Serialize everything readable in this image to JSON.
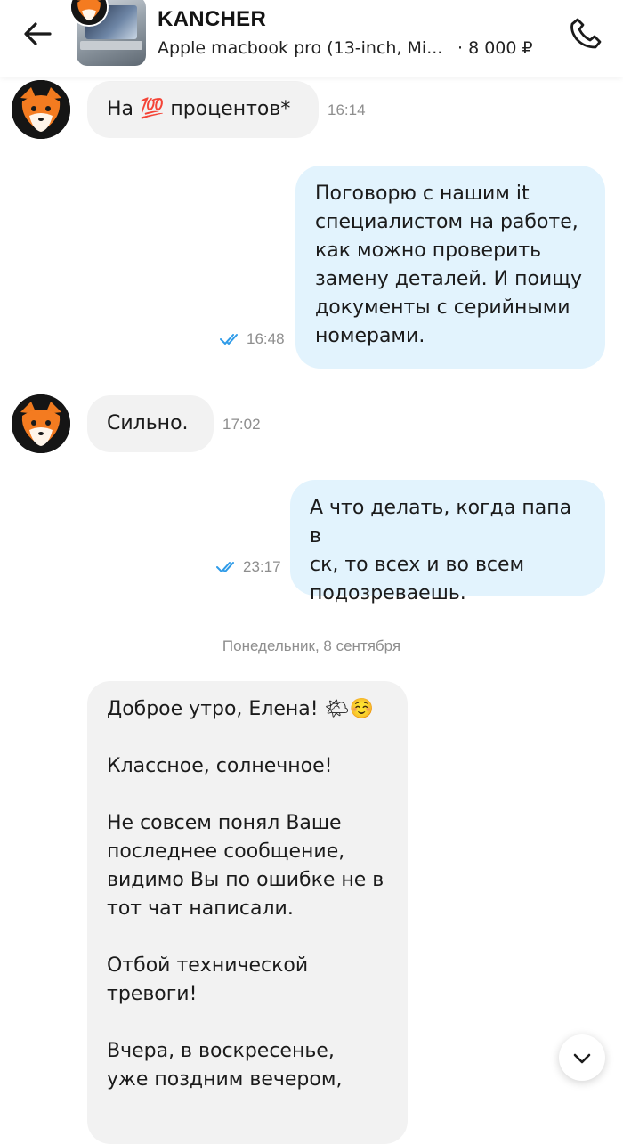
{
  "header": {
    "back_icon": "arrow-left-icon",
    "seller_name": "KANCHER",
    "listing_title": "Apple macbook pro (13-inch, Mi...",
    "listing_price": "· 8 000 ₽",
    "call_icon": "phone-icon"
  },
  "messages": [
    {
      "direction": "in",
      "text": "На 💯 процентов*",
      "time": "16:14"
    },
    {
      "direction": "out",
      "lines": [
        "Поговорю с нашим it",
        "специалистом на работе,",
        "как можно проверить",
        "замену деталей. И поищу",
        "документы с серийными",
        "номерами."
      ],
      "time": "16:48",
      "status": "read"
    },
    {
      "direction": "in",
      "text": "Сильно.",
      "time": "17:02"
    },
    {
      "direction": "out",
      "lines": [
        "А что делать, когда папа в",
        "ск, то всех и во всем",
        "подозреваешь."
      ],
      "time": "23:17",
      "status": "read"
    }
  ],
  "date_separator": "Понедельник, 8 сентября",
  "long_message": {
    "paragraphs": [
      [
        "Доброе утро, Елена! 🌤☺️"
      ],
      [
        "Классное, солнечное!"
      ],
      [
        "Не совсем понял Ваше",
        "последнее сообщение,",
        "видимо Вы по ошибке не в",
        "тот чат написали."
      ],
      [
        "Отбой технической",
        "тревоги!"
      ],
      [
        "Вчера, в воскресенье,",
        "уже поздним вечером,"
      ]
    ]
  },
  "scroll_down_icon": "chevron-down-icon",
  "colors": {
    "incoming_bubble": "#f2f2f2",
    "outgoing_bubble": "#e2f3fd",
    "read_ticks": "#2f9be8",
    "meta_text": "#8e8e8e"
  }
}
